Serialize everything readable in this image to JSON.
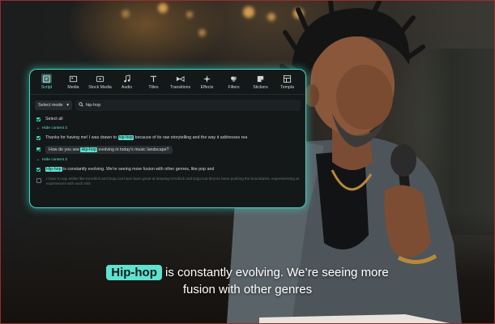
{
  "toolbar": {
    "tools": [
      {
        "label": "Script",
        "icon": "script-icon"
      },
      {
        "label": "Media",
        "icon": "media-icon"
      },
      {
        "label": "Stock Media",
        "icon": "stock-media-icon"
      },
      {
        "label": "Audio",
        "icon": "music-note-icon"
      },
      {
        "label": "Titles",
        "icon": "text-icon"
      },
      {
        "label": "Transitions",
        "icon": "transitions-icon"
      },
      {
        "label": "Effects",
        "icon": "sparkle-icon"
      },
      {
        "label": "Filters",
        "icon": "filters-icon"
      },
      {
        "label": "Stickers",
        "icon": "sticker-icon"
      },
      {
        "label": "Templa",
        "icon": "templates-icon"
      }
    ]
  },
  "search": {
    "mode": "Select mode",
    "query": "hip-hop"
  },
  "list": {
    "select_all": "Select all",
    "group1": "Hide content 3",
    "line1_pre": "Thanks for having me! I was drawn to ",
    "line1_hl": "hip-hop",
    "line1_post": " because of its raw storytelling and the way it addresses rea",
    "line2_pre": "How do you see ",
    "line2_hl": "Hip-hop",
    "line2_post": " evolving in today's music landscape?",
    "group2": "Hide content 3",
    "line3_hl": "Hip-hop",
    "line3_post": " is constantly evolving. We're seeing more fusion with other genres, like pop and",
    "line4": "I have to say artists like Kendrick and Doja Cat have been great at keeping Kendrick and Doja Cat they've been pushing the boundaries, experimenting with new sounds and",
    "line4b": "experiences with each visit"
  },
  "caption": {
    "highlight": "Hip-hop",
    "line1": " is constantly evolving. We’re seeing more",
    "line2": "fusion with other genres"
  },
  "colors": {
    "accent": "#5ee3d1",
    "panel": "#141819"
  }
}
